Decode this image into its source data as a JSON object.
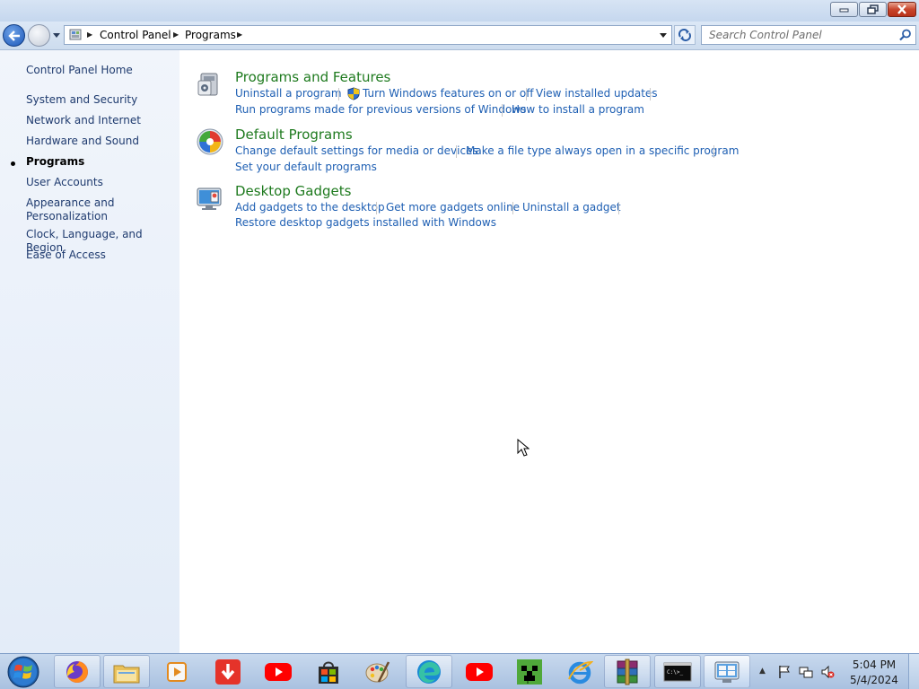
{
  "window": {
    "controls": {
      "minimize": "minimize-icon",
      "maximize": "restore-icon",
      "close": "close-icon"
    }
  },
  "nav": {
    "breadcrumb": [
      "Control Panel",
      "Programs"
    ],
    "search_placeholder": "Search Control Panel"
  },
  "sidebar": {
    "items": [
      {
        "label": "Control Panel Home",
        "active": false
      },
      {
        "label": "System and Security",
        "active": false
      },
      {
        "label": "Network and Internet",
        "active": false
      },
      {
        "label": "Hardware and Sound",
        "active": false
      },
      {
        "label": "Programs",
        "active": true
      },
      {
        "label": "User Accounts",
        "active": false
      },
      {
        "label": "Appearance and",
        "active": false
      },
      {
        "label": "Personalization",
        "active": false
      },
      {
        "label": "Clock, Language, and Region",
        "active": false
      },
      {
        "label": "Ease of Access",
        "active": false
      }
    ]
  },
  "categories": [
    {
      "title": "Programs and Features",
      "icon": "programs-features-icon",
      "links": [
        "Uninstall a program",
        "Turn Windows features on or off",
        "View installed updates",
        "Run programs made for previous versions of Windows",
        "How to install a program"
      ]
    },
    {
      "title": "Default Programs",
      "icon": "default-programs-icon",
      "links": [
        "Change default settings for media or devices",
        "Make a file type always open in a specific program",
        "Set your default programs"
      ]
    },
    {
      "title": "Desktop Gadgets",
      "icon": "desktop-gadgets-icon",
      "links": [
        "Add gadgets to the desktop",
        "Get more gadgets online",
        "Uninstall a gadget",
        "Restore desktop gadgets installed with Windows"
      ]
    }
  ],
  "taskbar": {
    "apps": [
      "firefox-icon",
      "file-explorer-icon",
      "media-player-icon",
      "download-manager-icon",
      "youtube-icon",
      "store-icon",
      "paint-icon",
      "edge-icon",
      "youtube-icon",
      "minecraft-icon",
      "internet-explorer-icon",
      "winrar-icon",
      "command-prompt-icon",
      "control-panel-icon"
    ],
    "tray_icons": [
      "action-center-flag-icon",
      "network-icon",
      "volume-muted-icon"
    ],
    "time": "5:04 PM",
    "date": "5/4/2024"
  },
  "colors": {
    "link": "#1e5fb3",
    "category_title": "#1e7a1e",
    "sidebar_bg": "#e3ecf8",
    "taskbar_bg": "#b9cfe8"
  }
}
